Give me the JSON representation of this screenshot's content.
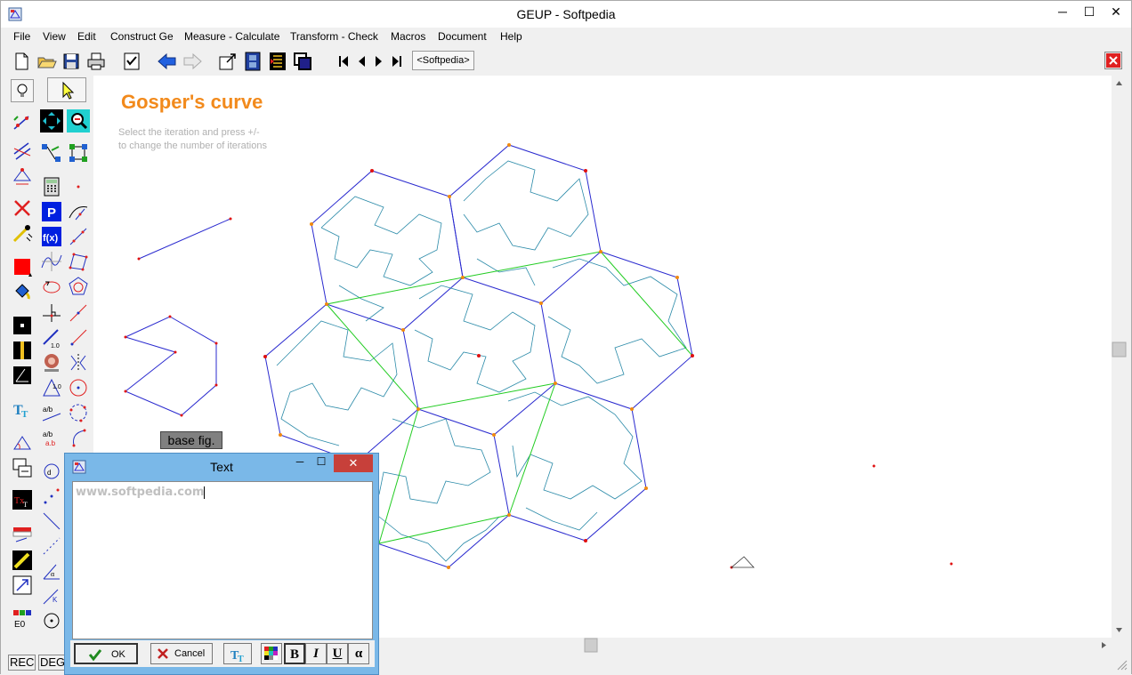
{
  "window": {
    "title": "GEUP - Softpedia",
    "minimize": "─",
    "maximize": "☐",
    "close": "✕"
  },
  "menu": [
    "File",
    "View",
    "Edit",
    "Construct Ge",
    "Measure - Calculate",
    "Transform - Check",
    "Macros",
    "Document",
    "Help"
  ],
  "toolbar": {
    "tab_label": "<Softpedia>"
  },
  "document": {
    "title": "Gosper's curve",
    "hint_line1": "Select the iteration and press +/-",
    "hint_line2": "to change the number of iterations",
    "base_fig_label": "base fig."
  },
  "statusbar": {
    "rec": "REC",
    "deg": "DEG"
  },
  "text_dialog": {
    "title": "Text",
    "minimize": "─",
    "maximize": "☐",
    "close": "✕",
    "content": "www.softpedia.com",
    "ok_label": "OK",
    "cancel_label": "Cancel",
    "bold_label": "B",
    "italic_label": "I",
    "underline_label": "U",
    "alpha_label": "α"
  },
  "colors": {
    "title_orange": "#f28a1c",
    "curve_blue": "#2a2acf",
    "curve_teal": "#2a8aa8",
    "guide_green": "#22cc22",
    "point_red": "#e01010",
    "point_orange": "#f08a10"
  }
}
